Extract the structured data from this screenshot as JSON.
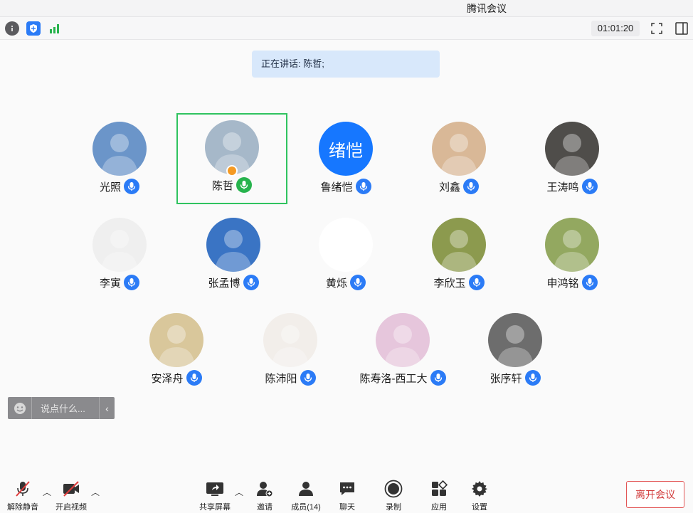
{
  "window": {
    "title": "腾讯会议"
  },
  "infobar": {
    "icons": [
      "info-icon",
      "shield-icon",
      "signal-icon"
    ],
    "timer": "01:01:20",
    "right_icons": [
      "fullscreen-icon",
      "sidebar-toggle-icon"
    ]
  },
  "speaking": {
    "text": "正在讲话: 陈哲;"
  },
  "participants": [
    {
      "name": "光照",
      "mic": "mic-icon",
      "avatar_color": "#6b95c9",
      "active": false
    },
    {
      "name": "陈哲",
      "mic": "mic-on-icon",
      "avatar_color": "#a6b8c9",
      "active": true,
      "host": true
    },
    {
      "name": "鲁绪恺",
      "mic": "mic-icon",
      "avatar_text": "绪恺",
      "avatar_color": "#1677ff",
      "active": false
    },
    {
      "name": "刘鑫",
      "mic": "mic-icon",
      "avatar_color": "#d9b897",
      "active": false
    },
    {
      "name": "王涛鸣",
      "mic": "mic-icon",
      "avatar_color": "#4f4d4a",
      "active": false
    },
    {
      "name": "李寅",
      "mic": "mic-icon",
      "avatar_color": "#efefef",
      "active": false
    },
    {
      "name": "张孟博",
      "mic": "mic-icon",
      "avatar_color": "#3a74c4",
      "active": false
    },
    {
      "name": "黄烁",
      "mic": "mic-icon",
      "avatar_color": "#ffffff",
      "active": false
    },
    {
      "name": "李欣玉",
      "mic": "mic-icon",
      "avatar_color": "#8c9a4e",
      "active": false
    },
    {
      "name": "申鸿铭",
      "mic": "mic-icon",
      "avatar_color": "#93a860",
      "active": false
    },
    {
      "name": "安泽舟",
      "mic": "mic-icon",
      "avatar_color": "#d9c79b",
      "active": false
    },
    {
      "name": "陈沛阳",
      "mic": "mic-icon",
      "avatar_color": "#f2eeea",
      "active": false
    },
    {
      "name": "陈寿洛-西工大",
      "mic": "mic-icon",
      "avatar_color": "#e6c6dc",
      "active": false
    },
    {
      "name": "张序轩",
      "mic": "mic-icon",
      "avatar_color": "#6d6d6d",
      "active": false
    }
  ],
  "chat": {
    "placeholder": "说点什么...",
    "icon": "emoji-icon"
  },
  "toolbar": {
    "unmute": "解除静音",
    "video": "开启视频",
    "share": "共享屏幕",
    "invite": "邀请",
    "members": "成员(14)",
    "chat": "聊天",
    "record": "录制",
    "apps": "应用",
    "settings": "设置",
    "leave": "离开会议"
  },
  "colors": {
    "accent": "#2b7bf6",
    "speaking_bg": "#d8e8fb",
    "active_border": "#2fc35f",
    "leave": "#d23c3c"
  }
}
